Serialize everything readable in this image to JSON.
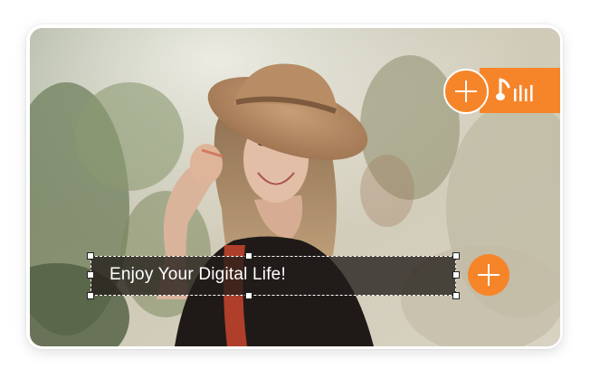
{
  "overlay": {
    "caption_text": "Enjoy Your Digital Life!"
  },
  "icons": {
    "add_text": "plus-icon",
    "add_audio": "plus-icon",
    "audio": "music-note-equalizer-icon"
  },
  "colors": {
    "accent": "#f6852a",
    "overlay_bg": "#231e1a",
    "caption": "#ffffff"
  }
}
